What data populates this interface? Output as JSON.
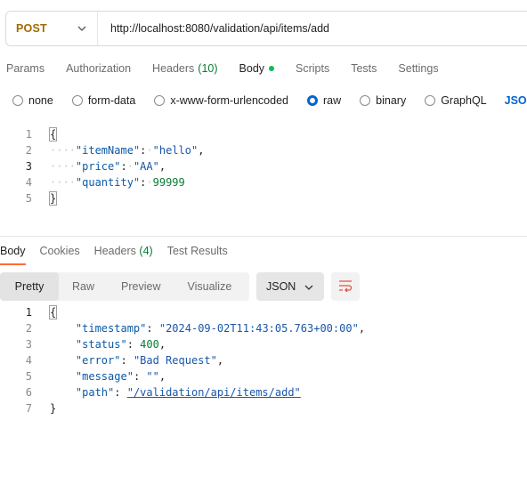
{
  "request": {
    "method": "POST",
    "url": "http://localhost:8080/validation/api/items/add"
  },
  "request_tabs": [
    {
      "label": "Params"
    },
    {
      "label": "Authorization"
    },
    {
      "label": "Headers",
      "count": "(10)"
    },
    {
      "label": "Body"
    },
    {
      "label": "Scripts"
    },
    {
      "label": "Tests"
    },
    {
      "label": "Settings"
    }
  ],
  "body_types": {
    "none": "none",
    "form_data": "form-data",
    "urlencoded": "x-www-form-urlencoded",
    "raw": "raw",
    "binary": "binary",
    "graphql": "GraphQL",
    "format": "JSON"
  },
  "request_body": {
    "line_numbers": [
      "1",
      "2",
      "3",
      "4",
      "5"
    ],
    "open_brace": "{",
    "close_brace": "}",
    "item_name_key": "\"itemName\"",
    "item_name_value": "\"hello\"",
    "price_key": "\"price\"",
    "price_value": "\"AA\"",
    "quantity_key": "\"quantity\"",
    "quantity_value": "99999"
  },
  "response_tabs": {
    "body": "Body",
    "cookies": "Cookies",
    "headers": "Headers",
    "headers_count": "(4)",
    "test_results": "Test Results"
  },
  "view_modes": {
    "pretty": "Pretty",
    "raw": "Raw",
    "preview": "Preview",
    "visualize": "Visualize",
    "format": "JSON"
  },
  "response_body": {
    "line_numbers": [
      "1",
      "2",
      "3",
      "4",
      "5",
      "6",
      "7"
    ],
    "open_brace": "{",
    "close_brace": "}",
    "timestamp_key": "\"timestamp\"",
    "timestamp_value": "\"2024-09-02T11:43:05.763+00:00\"",
    "status_key": "\"status\"",
    "status_value": "400",
    "error_key": "\"error\"",
    "error_value": "\"Bad Request\"",
    "message_key": "\"message\"",
    "message_value": "\"\"",
    "path_key": "\"path\"",
    "path_value": "\"/validation/api/items/add\""
  },
  "colors": {
    "method": "#a36a00",
    "accent": "#ff6c37",
    "link": "#0265d2",
    "count": "#0a7b35",
    "dot": "#0cbb52"
  }
}
